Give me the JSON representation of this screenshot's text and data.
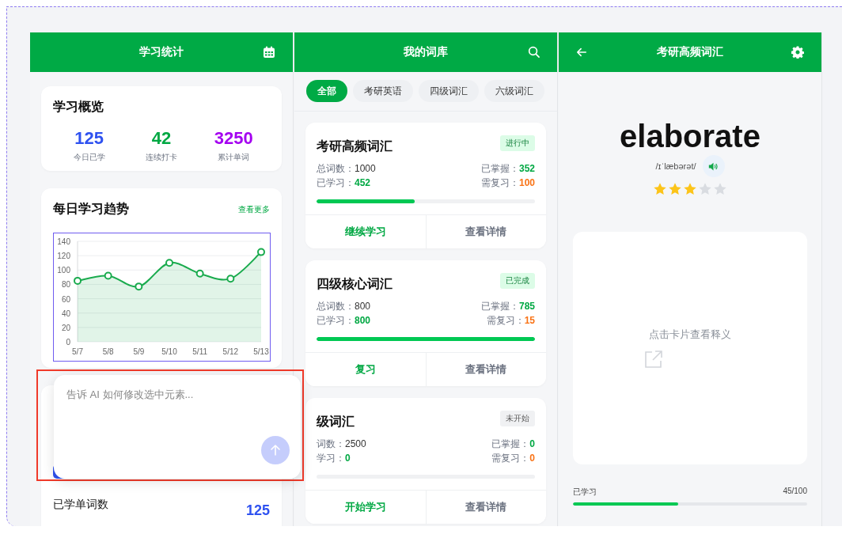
{
  "stats_panel": {
    "title": "学习统计",
    "overview": {
      "title": "学习概览",
      "stats": [
        {
          "value": "125",
          "label": "今日已学",
          "color": "#2f52f0"
        },
        {
          "value": "42",
          "label": "连续打卡",
          "color": "#00a843"
        },
        {
          "value": "3250",
          "label": "累计单词",
          "color": "#a400f0"
        }
      ]
    },
    "trend": {
      "title": "每日学习趋势",
      "link": "查看更多",
      "chart_data": {
        "type": "area",
        "categories": [
          "5/7",
          "5/8",
          "5/9",
          "5/10",
          "5/11",
          "5/12",
          "5/13"
        ],
        "series": [
          {
            "color": "#1aab4e",
            "values": [
              85,
              92,
              77,
              110,
              95,
              88,
              125
            ]
          }
        ],
        "grid": true,
        "ylim": [
          0,
          140
        ],
        "yticks": [
          0,
          20,
          40,
          60,
          80,
          100,
          120,
          140
        ]
      }
    },
    "summary": {
      "title": "已学单词数",
      "value": "125"
    }
  },
  "prompt": {
    "placeholder": "告诉 AI 如何修改选中元素..."
  },
  "library": {
    "title": "我的词库",
    "filters": [
      {
        "label": "全部",
        "selected": true
      },
      {
        "label": "考研英语",
        "selected": false
      },
      {
        "label": "四级词汇",
        "selected": false
      },
      {
        "label": "六级词汇",
        "selected": false
      }
    ],
    "books": [
      {
        "title": "考研高频词汇",
        "status": "进行中",
        "kind": "in_progress",
        "total_label": "总词数：",
        "total": "1000",
        "learned_label": "已学习：",
        "learned": "452",
        "mastered_label": "已掌握：",
        "mastered": "352",
        "review_label": "需复习：",
        "review": "100",
        "level": 0.45,
        "actions": [
          "继续学习",
          "查看详情"
        ]
      },
      {
        "title": "四级核心词汇",
        "status": "已完成",
        "kind": "done",
        "total_label": "总词数：",
        "total": "800",
        "learned_label": "已学习：",
        "learned": "800",
        "mastered_label": "已掌握：",
        "mastered": "785",
        "review_label": "需复习：",
        "review": "15",
        "level": 1,
        "actions": [
          "复习",
          "查看详情"
        ]
      },
      {
        "title": "级词汇",
        "status": "未开始",
        "kind": "not_started",
        "total_label": "词数：",
        "total": "2500",
        "learned_label": "学习：",
        "learned": "0",
        "mastered_label": "已掌握：",
        "mastered": "0",
        "review_label": "需复习：",
        "review": "0",
        "level": 0,
        "actions": [
          "开始学习",
          "查看详情"
        ]
      }
    ]
  },
  "study": {
    "title": "考研高频词汇",
    "word": "elaborate",
    "phonetic": "/ɪˈlæbərət/",
    "stars": 3,
    "hint": "点击卡片查看释义",
    "progress_label": "已学习",
    "progress_text": "45/100",
    "level": 0.45
  }
}
